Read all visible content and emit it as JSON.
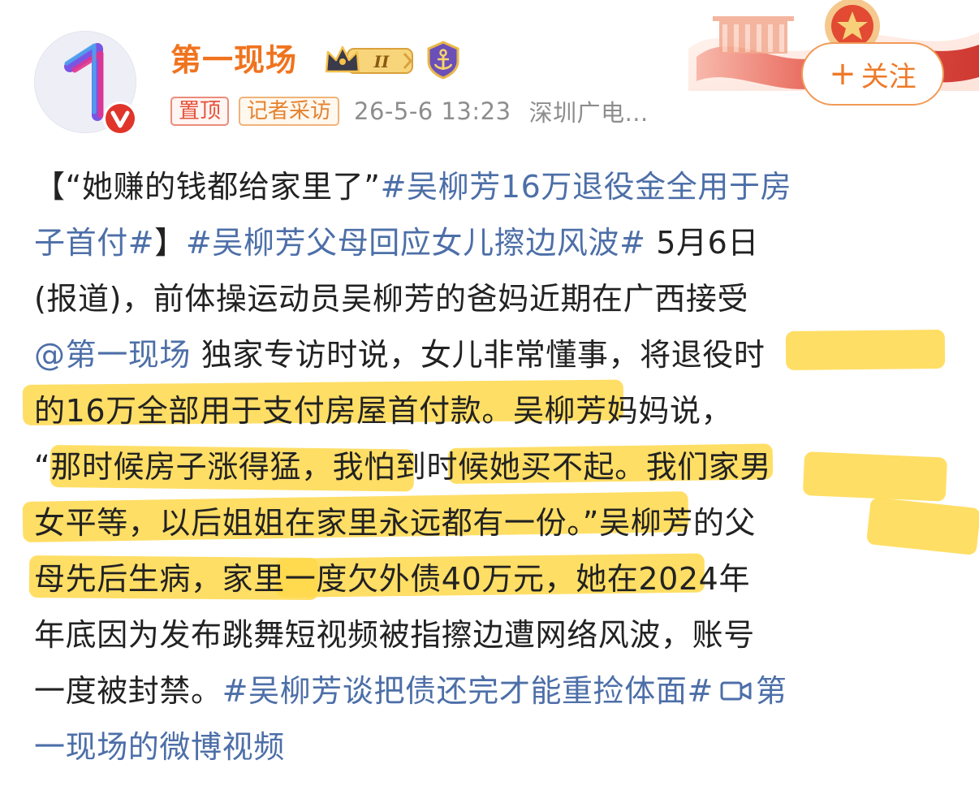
{
  "header": {
    "account_name": "第一现场",
    "level_badge": "II",
    "tags": [
      "置顶",
      "记者采访"
    ],
    "timestamp": "26-5-6 13:23",
    "source": "深圳广电...",
    "follow_label": "关注",
    "follow_symbol": "+"
  },
  "post": {
    "lines": [
      [
        {
          "t": "【“她赚的钱都给家里了”",
          "k": "text"
        },
        {
          "t": "#吴柳芳16万退役金全用于房",
          "k": "hashtag"
        }
      ],
      [
        {
          "t": "子首付#",
          "k": "hashtag"
        },
        {
          "t": "】",
          "k": "text"
        },
        {
          "t": "#吴柳芳父母回应女儿擦边风波#",
          "k": "hashtag"
        },
        {
          "t": " 5月6日",
          "k": "text"
        }
      ],
      [
        {
          "t": "(报道)，前体操运动员吴柳芳的爸妈近期在广西接受",
          "k": "text"
        }
      ],
      [
        {
          "t": " @第一现场",
          "k": "mention"
        },
        {
          "t": " 独家专访时说，女儿非常懂事，将退役时",
          "k": "text"
        }
      ],
      [
        {
          "t": "的16万全部用于支付房屋首付款。吴柳芳妈妈说，",
          "k": "text"
        }
      ],
      [
        {
          "t": "“那时候房子涨得猛，我怕到时候她买不起。我们家男",
          "k": "text"
        }
      ],
      [
        {
          "t": "女平等，以后姐姐在家里永远都有一份。”吴柳芳的父",
          "k": "text"
        }
      ],
      [
        {
          "t": "母先后生病，家里一度欠外债40万元，她在2024年",
          "k": "text"
        }
      ],
      [
        {
          "t": "年底因为发布跳舞短视频被指擦边遭网络风波，账号",
          "k": "text"
        }
      ],
      [
        {
          "t": "一度被封禁。",
          "k": "text"
        },
        {
          "t": "#吴柳芳谈把债还完才能重捡体面#",
          "k": "hashtag"
        },
        {
          "t": "第",
          "k": "video"
        }
      ],
      [
        {
          "t": "一现场的微博视频",
          "k": "video"
        }
      ]
    ]
  },
  "colors": {
    "name": "#f0731e",
    "link": "#4d6fa8",
    "highlight": "#ffd84a",
    "verified": "#e0352b"
  },
  "icons": {
    "avatar": "number-one-logo",
    "verified": "verified-v-icon",
    "level": "crown-level-icon",
    "badge": "anchor-shield-icon",
    "video": "video-camera-icon"
  }
}
